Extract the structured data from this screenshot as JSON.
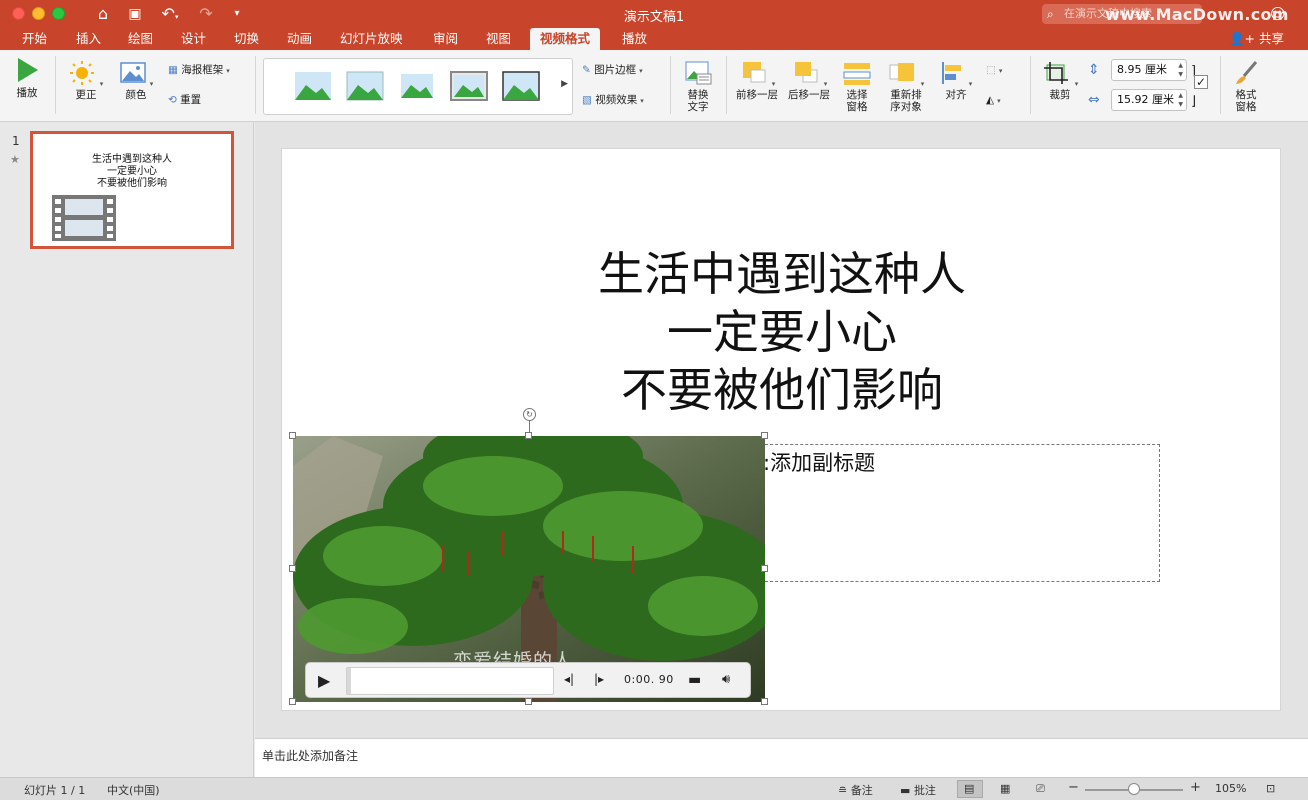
{
  "window": {
    "title": "演示文稿1",
    "search_placeholder": "在演示文稿中搜索",
    "watermark": "www.MacDown.com"
  },
  "tabs": [
    {
      "label": "开始"
    },
    {
      "label": "插入"
    },
    {
      "label": "绘图"
    },
    {
      "label": "设计"
    },
    {
      "label": "切换"
    },
    {
      "label": "动画"
    },
    {
      "label": "幻灯片放映"
    },
    {
      "label": "审阅"
    },
    {
      "label": "视图"
    },
    {
      "label": "视频格式",
      "active": true
    },
    {
      "label": "播放"
    }
  ],
  "share_label": "共享",
  "ribbon": {
    "play": "播放",
    "corrections": "更正",
    "color": "颜色",
    "poster_frame": "海报框架",
    "reset": "重置",
    "picture_border": "图片边框",
    "video_effects": "视频效果",
    "alt_text": [
      "替换",
      "文字"
    ],
    "bring_forward": "前移一层",
    "send_backward": "后移一层",
    "selection_pane": [
      "选择",
      "窗格"
    ],
    "reorder": [
      "重新排",
      "序对象"
    ],
    "align": "对齐",
    "crop": "裁剪",
    "height_value": "8.95 厘米",
    "width_value": "15.92 厘米",
    "format_pane": [
      "格式",
      "窗格"
    ]
  },
  "slide_panel": {
    "slide_number": "1",
    "thumb_lines": [
      "生活中遇到这种人",
      "一定要小心",
      "不要被他们影响"
    ]
  },
  "slide": {
    "title_lines": [
      "生活中遇到这种人",
      "一定要小心",
      "不要被他们影响"
    ],
    "subtitle_placeholder": ":添加副标题",
    "video_caption": "恋爱结婚的人",
    "video_time": "0:00. 90",
    "video_progress": 0.02
  },
  "notes_placeholder": "单击此处添加备注",
  "status": {
    "slide_count": "幻灯片 1 / 1",
    "language": "中文(中国)",
    "notes": "备注",
    "comments": "批注",
    "zoom": "105%"
  },
  "colors": {
    "accent": "#c8442a",
    "selection_border": "#d2553b"
  }
}
